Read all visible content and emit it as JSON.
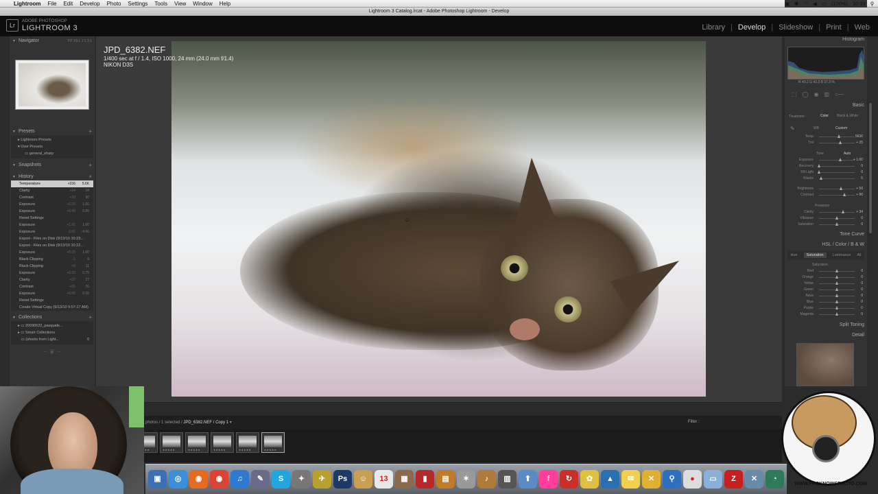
{
  "menubar": {
    "items": [
      "Lightroom",
      "File",
      "Edit",
      "Develop",
      "Photo",
      "Settings",
      "Tools",
      "View",
      "Window",
      "Help"
    ],
    "battery": "(100%)",
    "clock": "Mon 10:33 AM"
  },
  "window_title": "Lightroom 3 Catalog.lrcat - Adobe Photoshop Lightroom - Develop",
  "identity": {
    "logo": "Lr",
    "brand_small": "ADOBE PHOTOSHOP",
    "brand_big": "LIGHTROOM 3"
  },
  "modules": [
    "Library",
    "Develop",
    "Slideshow",
    "Print",
    "Web"
  ],
  "navigator": {
    "title": "Navigator",
    "zoom": "FIT  FILL  1:1  3:1"
  },
  "presets": {
    "title": "Presets",
    "items": [
      "Lightroom Presets",
      "User Presets",
      "general_sharp"
    ]
  },
  "snapshots": {
    "title": "Snapshots"
  },
  "history": {
    "title": "History",
    "items": [
      {
        "label": "Temperature",
        "a": "+236",
        "b": "5.6K"
      },
      {
        "label": "Clarity",
        "a": "+24",
        "b": "34"
      },
      {
        "label": "Contrast",
        "a": "+30",
        "b": "90"
      },
      {
        "label": "Exposure",
        "a": "+0.15",
        "b": "1.00"
      },
      {
        "label": "Exposure",
        "a": "+0.45",
        "b": "0.85"
      },
      {
        "label": "Reset Settings",
        "a": "",
        "b": ""
      },
      {
        "label": "Exposure",
        "a": "+1.00",
        "b": "1.00"
      },
      {
        "label": "Exposure",
        "a": "-3.00",
        "b": "-4.00"
      },
      {
        "label": "Export - Files on Disk (9/13/10 10:23...",
        "a": "",
        "b": ""
      },
      {
        "label": "Export - Files on Disk (9/13/10 10:22...",
        "a": "",
        "b": ""
      },
      {
        "label": "Exposure",
        "a": "+0.25",
        "b": "1.00"
      },
      {
        "label": "Black Clipping",
        "a": "-1",
        "b": "9"
      },
      {
        "label": "Black Clipping",
        "a": "+5",
        "b": "11"
      },
      {
        "label": "Exposure",
        "a": "+0.20",
        "b": "0.75"
      },
      {
        "label": "Clarity",
        "a": "+27",
        "b": "27"
      },
      {
        "label": "Contrast",
        "a": "+31",
        "b": "76"
      },
      {
        "label": "Exposure",
        "a": "+0.55",
        "b": "0.55"
      },
      {
        "label": "Reset Settings",
        "a": "",
        "b": ""
      },
      {
        "label": "Create Virtual Copy (9/13/10 9:57:17 AM)",
        "a": "",
        "b": ""
      }
    ]
  },
  "collections": {
    "title": "Collections",
    "items": [
      "20090622_pasquale...",
      "Smart Collections",
      "(shoots from Light..."
    ],
    "last_count": "0"
  },
  "photo": {
    "filename": "JPD_6382.NEF",
    "line2": "1/400 sec at f / 1.4, ISO 1000, 24 mm (24.0 mm f/1.4)",
    "camera": "NIKON D3S"
  },
  "filmstrip": {
    "path_prefix": "photos / 1 selected / ",
    "path_file": "JPD_6382.NEF / Copy 1",
    "filter_label": "Filter :",
    "stars": "★★★★★"
  },
  "right_panel": {
    "histogram_title": "Histogram",
    "rgb_readout": "R  43.2   G  42.2   B  37.3  %",
    "basic_title": "Basic",
    "treatment_label": "Treatment :",
    "treatment_color": "Color",
    "treatment_bw": "Black & White",
    "wb_label": "WB :",
    "wb_value": "Custom",
    "tone_label": "Tone",
    "auto_label": "Auto",
    "presence_label": "Presence",
    "sliders_wb": [
      {
        "label": "Temp",
        "value": "5636",
        "pos": 0.55
      },
      {
        "label": "Tint",
        "value": "+ 25",
        "pos": 0.6
      }
    ],
    "sliders_tone": [
      {
        "label": "Exposure",
        "value": "+ 1.00",
        "pos": 0.6
      },
      {
        "label": "Recovery",
        "value": "0",
        "pos": 0.0
      },
      {
        "label": "Fill Light",
        "value": "0",
        "pos": 0.0
      },
      {
        "label": "Blacks",
        "value": "5",
        "pos": 0.05
      },
      {
        "label": "Brightness",
        "value": "+ 50",
        "pos": 0.62
      },
      {
        "label": "Contrast",
        "value": "+ 90",
        "pos": 0.72
      }
    ],
    "sliders_presence": [
      {
        "label": "Clarity",
        "value": "+ 34",
        "pos": 0.67
      },
      {
        "label": "Vibrance",
        "value": "0",
        "pos": 0.5
      },
      {
        "label": "Saturation",
        "value": "0",
        "pos": 0.5
      }
    ],
    "tone_curve_title": "Tone Curve",
    "hsl_title": "HSL  /  Color  /  B & W",
    "hsl_tabs": [
      "Hue",
      "Saturation",
      "Luminance",
      "All"
    ],
    "saturation_label": "Saturation",
    "hsl_sliders": [
      {
        "label": "Red",
        "value": "0",
        "pos": 0.5
      },
      {
        "label": "Orange",
        "value": "0",
        "pos": 0.5
      },
      {
        "label": "Yellow",
        "value": "0",
        "pos": 0.5
      },
      {
        "label": "Green",
        "value": "0",
        "pos": 0.5
      },
      {
        "label": "Aqua",
        "value": "0",
        "pos": 0.5
      },
      {
        "label": "Blue",
        "value": "0",
        "pos": 0.5
      },
      {
        "label": "Purple",
        "value": "0",
        "pos": 0.5
      },
      {
        "label": "Magenta",
        "value": "0",
        "pos": 0.5
      }
    ],
    "split_toning_title": "Split Toning",
    "detail_title": "Detail"
  },
  "avatar": {
    "tag": "WWW.FROKNOWSPHOTO.COM"
  },
  "dock": {
    "icons": [
      {
        "name": "preview-icon",
        "glyph": "▣",
        "color": "#3d6fb5"
      },
      {
        "name": "safari-icon",
        "glyph": "◎",
        "color": "#3a8fd8"
      },
      {
        "name": "firefox-icon",
        "glyph": "◉",
        "color": "#e66a1f"
      },
      {
        "name": "chrome-icon",
        "glyph": "◉",
        "color": "#d94436"
      },
      {
        "name": "itunes-icon",
        "glyph": "♫",
        "color": "#2f7ad1"
      },
      {
        "name": "brush-icon",
        "glyph": "✎",
        "color": "#6a6a8a"
      },
      {
        "name": "skype-icon",
        "glyph": "S",
        "color": "#22a6e0"
      },
      {
        "name": "utility-icon",
        "glyph": "✦",
        "color": "#777"
      },
      {
        "name": "bird-icon",
        "glyph": "✈",
        "color": "#b8a030"
      },
      {
        "name": "photoshop-icon",
        "glyph": "Ps",
        "color": "#1d3a66"
      },
      {
        "name": "finder-icon",
        "glyph": "☺",
        "color": "#c8a050"
      },
      {
        "name": "calendar-icon",
        "glyph": "13",
        "color": "#e8e8e8"
      },
      {
        "name": "photos-icon",
        "glyph": "▦",
        "color": "#8a6a4a"
      },
      {
        "name": "photobooth-icon",
        "glyph": "▮",
        "color": "#b5282c"
      },
      {
        "name": "photo-app-icon",
        "glyph": "▤",
        "color": "#c07a2a"
      },
      {
        "name": "star-icon",
        "glyph": "✶",
        "color": "#999"
      },
      {
        "name": "guitar-icon",
        "glyph": "♪",
        "color": "#b07a3a"
      },
      {
        "name": "clapper-icon",
        "glyph": "▥",
        "color": "#555"
      },
      {
        "name": "upload-icon",
        "glyph": "⬆",
        "color": "#5b8ac8"
      },
      {
        "name": "flickr-icon",
        "glyph": "f",
        "color": "#ff3d9a"
      },
      {
        "name": "sync-icon",
        "glyph": "↻",
        "color": "#c9302c"
      },
      {
        "name": "fruit-icon",
        "glyph": "✿",
        "color": "#e0c040"
      },
      {
        "name": "stocks-icon",
        "glyph": "▲",
        "color": "#2a6fb0"
      },
      {
        "name": "notes-icon",
        "glyph": "✉",
        "color": "#f0d050"
      },
      {
        "name": "tools-icon",
        "glyph": "✕",
        "color": "#e0b030"
      },
      {
        "name": "search-icon",
        "glyph": "⚲",
        "color": "#2f6fc0"
      },
      {
        "name": "dvd-icon",
        "glyph": "●",
        "color": "#ddd"
      },
      {
        "name": "folder-icon",
        "glyph": "▭",
        "color": "#8ab0d8"
      },
      {
        "name": "filezilla-icon",
        "glyph": "Z",
        "color": "#c42020"
      },
      {
        "name": "xcode-icon",
        "glyph": "✕",
        "color": "#6a8aaa"
      },
      {
        "name": "timemachine-icon",
        "glyph": "◔",
        "color": "#2d7a5a"
      }
    ]
  }
}
